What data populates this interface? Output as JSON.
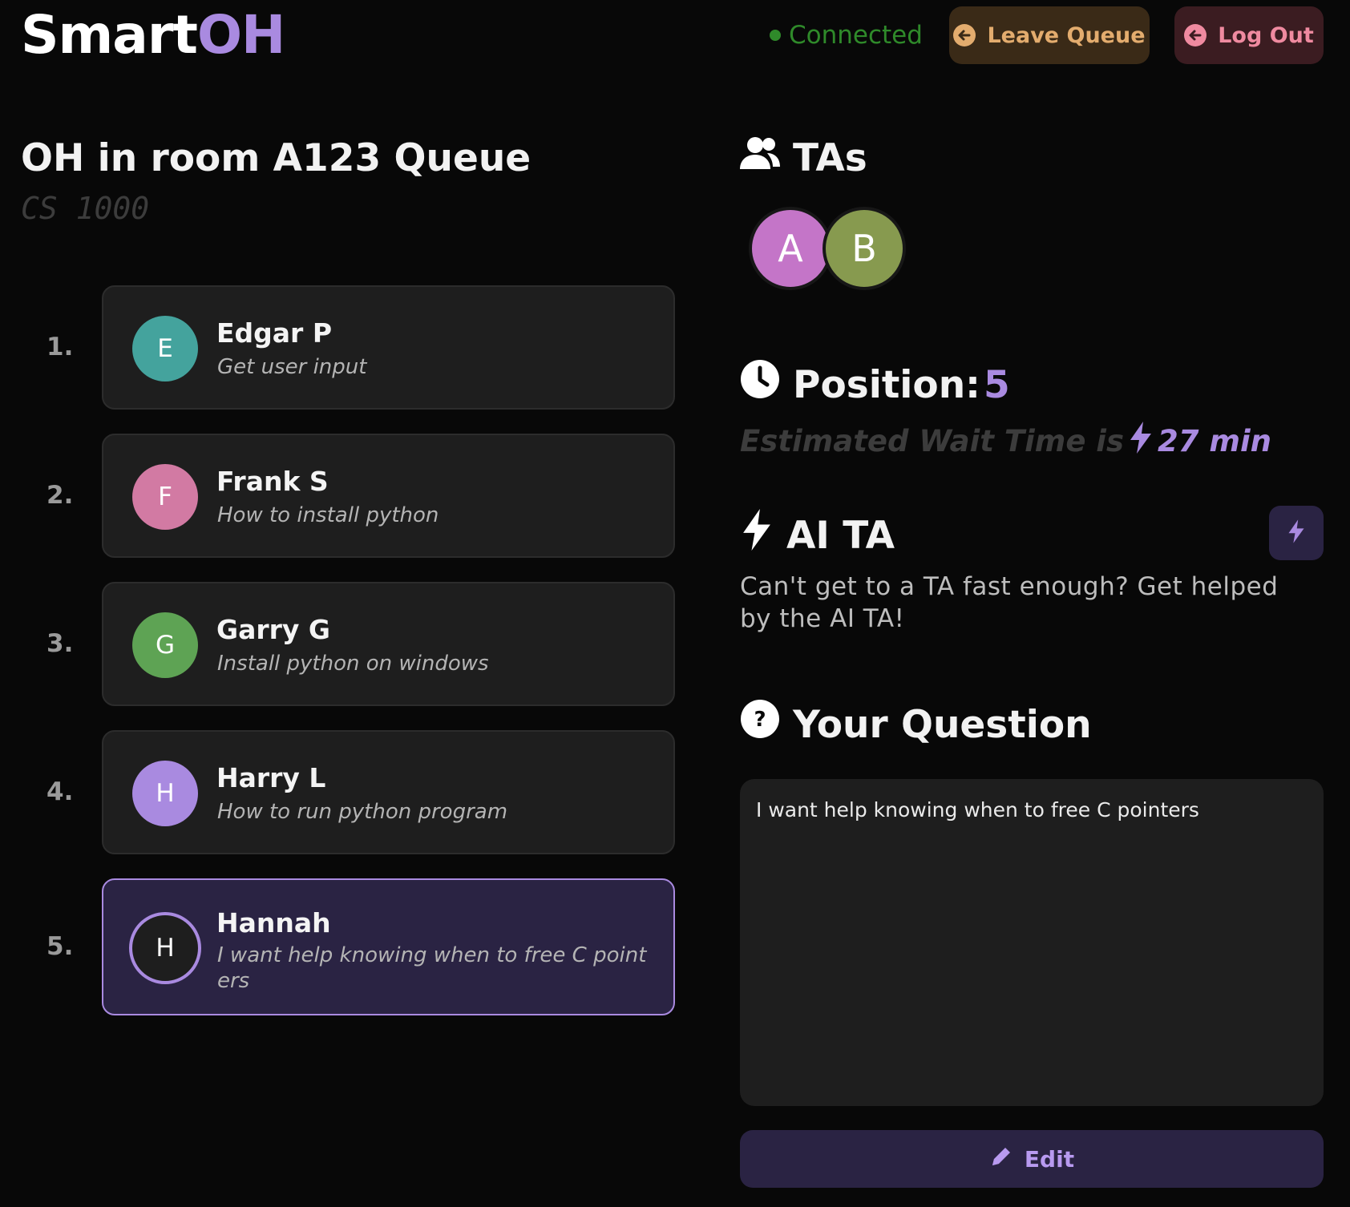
{
  "header": {
    "logo_main": "Smart",
    "logo_accent": "OH",
    "status": "Connected",
    "leave_label": "Leave Queue",
    "logout_label": "Log Out"
  },
  "queue": {
    "title": "OH in room A123 Queue",
    "course": "CS 1000",
    "entries": [
      {
        "num": "1.",
        "initial": "E",
        "name": "Edgar P",
        "question": "Get user input",
        "color": "#44a39d"
      },
      {
        "num": "2.",
        "initial": "F",
        "name": "Frank S",
        "question": "How to install python",
        "color": "#d27aa3"
      },
      {
        "num": "3.",
        "initial": "G",
        "name": "Garry G",
        "question": "Install python on windows",
        "color": "#5ea354"
      },
      {
        "num": "4.",
        "initial": "H",
        "name": "Harry L",
        "question": "How to run python program",
        "color": "#a98ae0"
      },
      {
        "num": "5.",
        "initial": "H",
        "name": "Hannah",
        "question": "I want help knowing when to free C pointers",
        "color": "#1e1e1e"
      }
    ]
  },
  "tas": {
    "title": "TAs",
    "avatars": [
      {
        "initial": "A",
        "color": "#c475c8"
      },
      {
        "initial": "B",
        "color": "#879a4f"
      }
    ]
  },
  "position": {
    "label": "Position:",
    "value": "5",
    "wait_prefix": "Estimated Wait Time is",
    "wait_value": "27 min"
  },
  "ai_ta": {
    "title": "AI TA",
    "description": "Can't get to a TA fast enough? Get helped by the AI TA!"
  },
  "your_question": {
    "title": "Your Question",
    "text": "I want help knowing when to free C pointers",
    "edit_label": "Edit"
  },
  "colors": {
    "accent": "#a98ae0",
    "connected": "#2f8a2a",
    "leave": "#e3ac6e",
    "logout": "#ef8aa0"
  }
}
